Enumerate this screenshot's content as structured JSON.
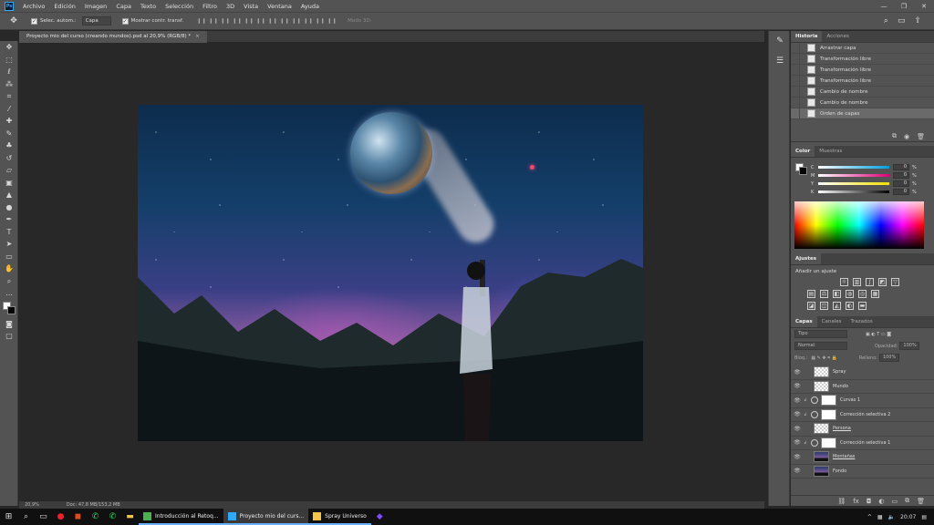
{
  "app": {
    "logo": "Ps"
  },
  "menu": [
    "Archivo",
    "Edición",
    "Imagen",
    "Capa",
    "Texto",
    "Selección",
    "Filtro",
    "3D",
    "Vista",
    "Ventana",
    "Ayuda"
  ],
  "window_controls": [
    "—",
    "❐",
    "✕"
  ],
  "options": {
    "auto_select_label": "Selec. autom.:",
    "auto_select_value": "Capa",
    "show_transform_label": "Mostrar contr. transf.",
    "mode3d_label": "Modo 3D:"
  },
  "document_tab": {
    "title": "Proyecto mio del curso (creando mundos).psd al 20,9% (RGB/8) *",
    "close": "×"
  },
  "status": {
    "zoom": "20,9%",
    "doc": "Doc: 47,8 MB/153,2 MB"
  },
  "history": {
    "tabs": [
      "Historia",
      "Acciones"
    ],
    "items": [
      "Arrastrar capa",
      "Transformación libre",
      "Transformación libre",
      "Transformación libre",
      "Cambio de nombre",
      "Cambio de nombre",
      "Orden de capas"
    ],
    "selected_index": 6
  },
  "color_panel": {
    "tabs": [
      "Color",
      "Muestras"
    ],
    "channels": [
      {
        "label": "C",
        "value": "0",
        "color_from": "#ffffff",
        "color_to": "#00a0e0"
      },
      {
        "label": "M",
        "value": "0",
        "color_from": "#ffffff",
        "color_to": "#e0007a"
      },
      {
        "label": "Y",
        "value": "0",
        "color_from": "#ffffff",
        "color_to": "#f0e000"
      },
      {
        "label": "K",
        "value": "0",
        "color_from": "#ffffff",
        "color_to": "#000000"
      }
    ],
    "unit": "%"
  },
  "adjustments": {
    "tabs": [
      "Ajustes"
    ],
    "add_label": "Añadir un ajuste"
  },
  "layers": {
    "tabs": [
      "Capas",
      "Canales",
      "Trazados"
    ],
    "filter_label": "Tipo",
    "blend_mode": "Normal",
    "opacity_label": "Opacidad:",
    "opacity_value": "100%",
    "lock_label": "Bloq.:",
    "fill_label": "Relleno:",
    "fill_value": "100%",
    "rows": [
      {
        "name": "Spray",
        "type": "checker",
        "underline": false
      },
      {
        "name": "Mundo",
        "type": "checker",
        "underline": false
      },
      {
        "name": "Curvas 1",
        "type": "adjust",
        "underline": false
      },
      {
        "name": "Corrección selectiva 2",
        "type": "adjust",
        "underline": false
      },
      {
        "name": "Persona",
        "type": "checker",
        "underline": true
      },
      {
        "name": "Corrección selectiva 1",
        "type": "adjust",
        "underline": false
      },
      {
        "name": "Montañas",
        "type": "photo",
        "underline": true
      },
      {
        "name": "Fondo",
        "type": "photo",
        "underline": false
      }
    ]
  },
  "taskbar": {
    "tasks": [
      {
        "label": "Introducción al Retoq...",
        "icon_color": "#4caf50",
        "active": false
      },
      {
        "label": "Proyecto mio del curs...",
        "icon_color": "#31a8ff",
        "active": true
      },
      {
        "label": "Spray Universo",
        "icon_color": "#f5c542",
        "active": false
      }
    ],
    "time": "20:07"
  }
}
